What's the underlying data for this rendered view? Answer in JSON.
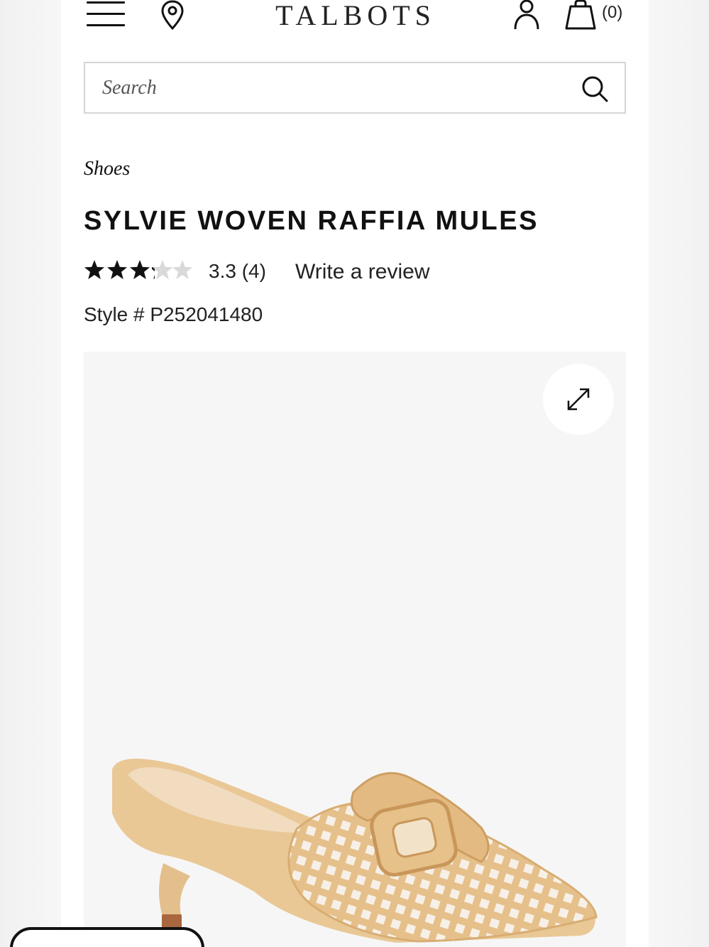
{
  "header": {
    "brand": "TALBOTS",
    "cart_count": "(0)",
    "icons": [
      "menu-icon",
      "location-pin-icon",
      "account-icon",
      "shopping-bag-icon"
    ]
  },
  "search": {
    "placeholder": "Search",
    "value": ""
  },
  "product": {
    "category": "Shoes",
    "title": "SYLVIE WOVEN RAFFIA MULES",
    "rating": 3.3,
    "rating_text": "3.3 (4)",
    "review_count": 4,
    "write_review_label": "Write a review",
    "style_number": "Style # P252041480"
  },
  "colors": {
    "star_filled": "#111111",
    "star_empty": "#d9d9d9",
    "image_bg": "#f6f6f6",
    "raffia": "#e9c896"
  }
}
